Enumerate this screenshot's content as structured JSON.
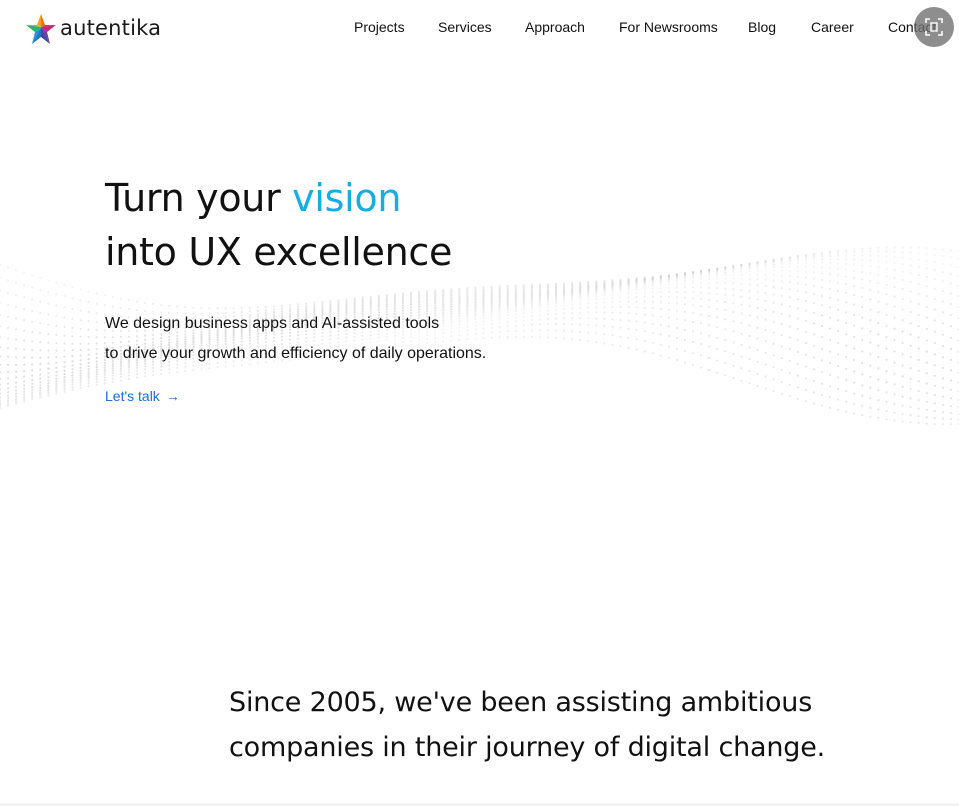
{
  "header": {
    "logo_text": "autentika",
    "nav": [
      {
        "label": "Projects"
      },
      {
        "label": "Services"
      },
      {
        "label": "Approach"
      },
      {
        "label": "For Newsrooms"
      },
      {
        "label": "Blog"
      },
      {
        "label": "Career"
      },
      {
        "label": "Contact"
      }
    ],
    "overlay_icon": "screen-capture-icon"
  },
  "hero": {
    "title_part1": "Turn your ",
    "title_accent": "vision",
    "title_line2": "into UX excellence",
    "subtitle_line1": "We design business apps and AI-assisted tools",
    "subtitle_line2": "to drive your growth and efficiency of daily operations.",
    "cta_label": "Let's talk",
    "cta_arrow": "→"
  },
  "intro": {
    "line1": "Since 2005, we've been assisting ambitious",
    "line2": "companies in their journey of digital change."
  },
  "colors": {
    "accent": "#15ade3",
    "link": "#1a6ed8",
    "text": "#111111"
  }
}
